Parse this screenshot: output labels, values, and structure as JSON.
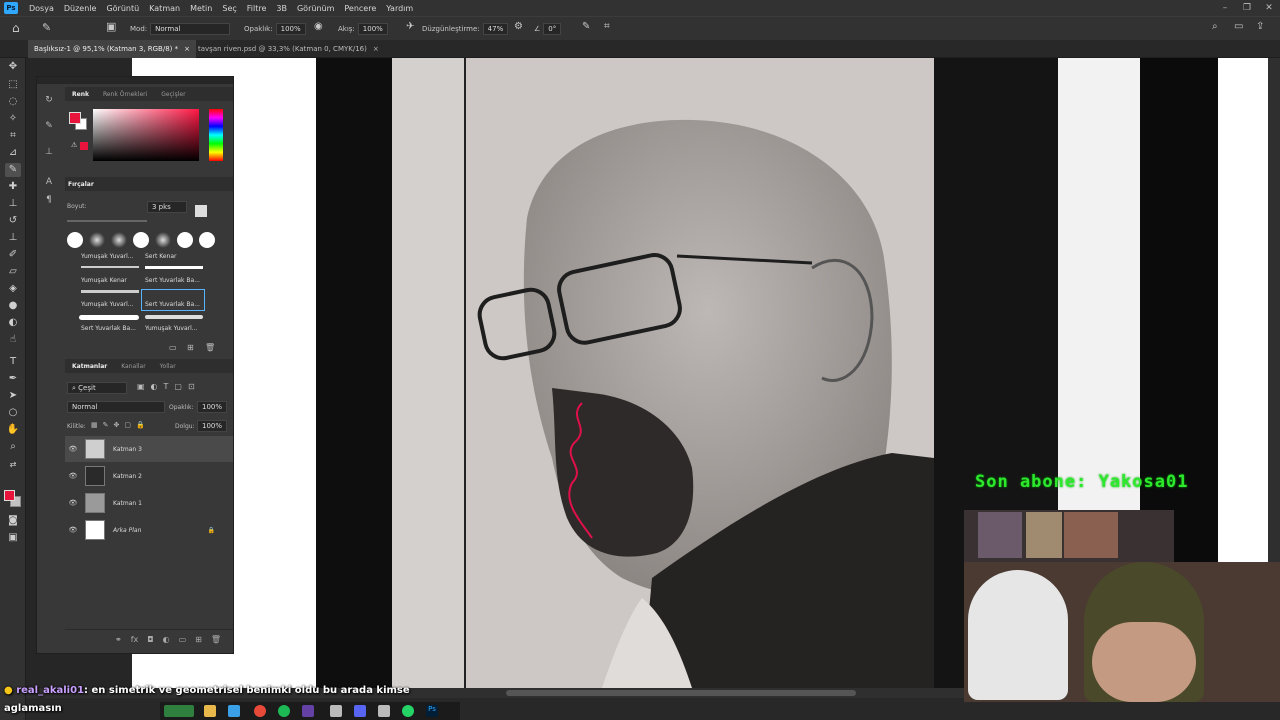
{
  "app": {
    "logo": "Ps"
  },
  "menu": [
    "Dosya",
    "Düzenle",
    "Görüntü",
    "Katman",
    "Metin",
    "Seç",
    "Filtre",
    "3B",
    "Görünüm",
    "Pencere",
    "Yardım"
  ],
  "options": {
    "mode_label": "Mod:",
    "mode_value": "Normal",
    "opacity_label": "Opaklık:",
    "opacity_value": "100%",
    "flow_label": "Akış:",
    "flow_value": "100%",
    "smoothing_label": "Düzgünleştirme:",
    "smoothing_value": "47%",
    "angle_value": "0°"
  },
  "tabs": [
    {
      "label": "Başlıksız-1 @ 95,1% (Katman 3, RGB/8) *",
      "close": "×"
    },
    {
      "label": "tavşan riven.psd @ 33,3% (Katman 0, CMYK/16)",
      "close": "×"
    }
  ],
  "color_panel": {
    "tabs": [
      "Renk",
      "Renk Örnekleri",
      "Geçişler"
    ],
    "foreground": "#e8143c",
    "background": "#ffffff"
  },
  "brushes_panel": {
    "title": "Fırçalar",
    "size_label": "Boyut:",
    "size_value": "3 pks",
    "brushes": [
      "Yumuşak Yuvarl...",
      "Sert Kenar",
      "Yumuşak Kenar",
      "Sert Yuvarlak Ba...",
      "Yumuşak Yuvarl...",
      "Sert Yuvarlak Ba...",
      "Sert Yuvarlak Ba...",
      "Yumuşak Yuvarl..."
    ]
  },
  "layers_panel": {
    "tabs": [
      "Katmanlar",
      "Kanallar",
      "Yollar"
    ],
    "filter_label": "Çeşit",
    "blend_mode": "Normal",
    "opacity_label": "Opaklık:",
    "opacity_value": "100%",
    "lock_label": "Kilitle:",
    "fill_label": "Dolgu:",
    "fill_value": "100%",
    "layers": [
      {
        "name": "Katman 3",
        "active": true
      },
      {
        "name": "Katman 2",
        "active": false
      },
      {
        "name": "Katman 1",
        "active": false
      },
      {
        "name": "Arka Plan",
        "active": false,
        "locked": true
      }
    ]
  },
  "overlay": {
    "subscriber": "Son abone: Yakosa01",
    "chat_user": "real_akali01",
    "chat_message_line1": ": en simetrik ve geometrisel benimki oldu bu arada kimse",
    "chat_message_line2": "aglamasın"
  },
  "colors": {
    "accent": "#31a8ff",
    "overlay_green": "#2ee82e",
    "chat_user": "#c9a0ff"
  }
}
